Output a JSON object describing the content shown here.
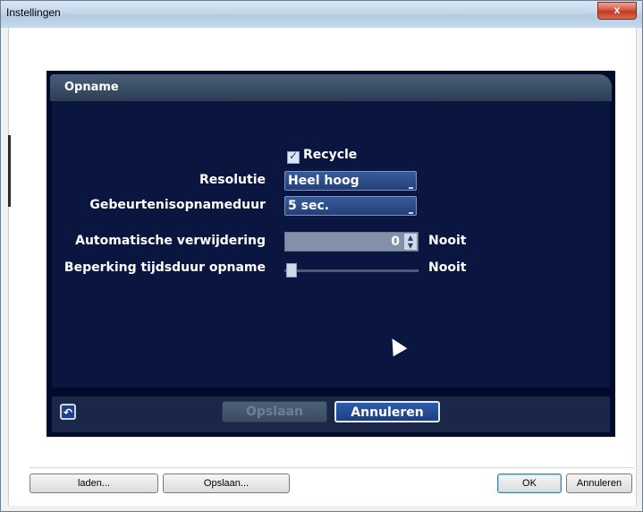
{
  "window": {
    "title": "Instellingen",
    "close_label": "x"
  },
  "panel": {
    "header": "Opname",
    "recycle": {
      "label": "Recycle",
      "checked": true
    },
    "resolution": {
      "label": "Resolutie",
      "value": "Heel hoog"
    },
    "event_duration": {
      "label": "Gebeurtenisopnameduur",
      "value": "5 sec."
    },
    "auto_delete": {
      "label": "Automatische verwijdering",
      "value": "0",
      "unit": "Nooit"
    },
    "duration_limit": {
      "label": "Beperking tijdsduur opname",
      "unit": "Nooit",
      "level": 0
    },
    "footer": {
      "save_label": "Opslaan",
      "cancel_label": "Annuleren"
    }
  },
  "bottom_bar": {
    "load_label": "laden...",
    "save_label": "Opslaan...",
    "ok_label": "OK",
    "cancel_label": "Annuleren"
  }
}
